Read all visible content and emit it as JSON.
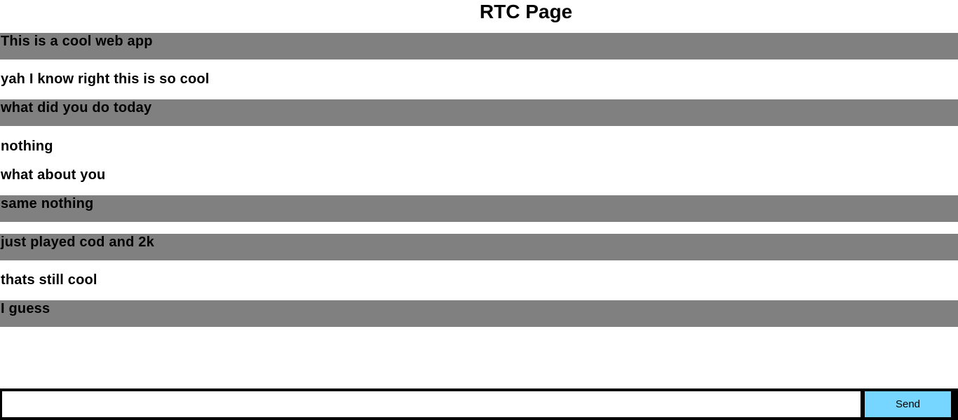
{
  "page": {
    "title": "RTC Page"
  },
  "messages": [
    {
      "text": "This is a cool web app",
      "style": "grey"
    },
    {
      "text": "yah I know right this is so cool",
      "style": "plain"
    },
    {
      "text": "what did you do today",
      "style": "grey"
    },
    {
      "text": "nothing",
      "style": "plain"
    },
    {
      "text": "what about you",
      "style": "plain"
    },
    {
      "text": "same nothing",
      "style": "grey"
    },
    {
      "text": "just played cod and 2k",
      "style": "grey"
    },
    {
      "text": "thats still cool",
      "style": "plain"
    },
    {
      "text": "I guess",
      "style": "grey"
    }
  ],
  "composer": {
    "input_value": "",
    "placeholder": "",
    "send_label": "Send"
  },
  "colors": {
    "grey_message_bg": "#808080",
    "send_button_bg": "#77d6ff",
    "composer_border": "#000000"
  }
}
